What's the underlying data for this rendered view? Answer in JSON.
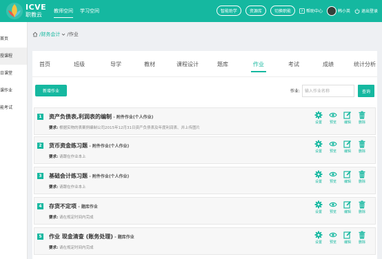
{
  "header": {
    "brand_main": "ICVE",
    "brand_sub": "职教云",
    "nav": [
      {
        "label": "教师空间",
        "active": true
      },
      {
        "label": "学习空间",
        "active": false
      }
    ],
    "pills": [
      "智能助学",
      "资源库",
      "切换职能"
    ],
    "help": "帮助中心",
    "user": "韩小英",
    "logout": "退出登录"
  },
  "sidebar": {
    "items": [
      {
        "label": "首页",
        "active": false
      },
      {
        "label": "授课程",
        "active": true
      },
      {
        "label": "日课堂",
        "active": false
      },
      {
        "label": "课作业",
        "active": false
      },
      {
        "label": "能考试",
        "active": false
      }
    ]
  },
  "breadcrumb": {
    "root": "/财务会计",
    "current": "/作业"
  },
  "tabs": [
    {
      "label": "首页",
      "active": false
    },
    {
      "label": "班级",
      "active": false
    },
    {
      "label": "导学",
      "active": false
    },
    {
      "label": "教材",
      "active": false
    },
    {
      "label": "课程设计",
      "active": false
    },
    {
      "label": "题库",
      "active": false
    },
    {
      "label": "作业",
      "active": true
    },
    {
      "label": "考试",
      "active": false
    },
    {
      "label": "成绩",
      "active": false
    },
    {
      "label": "统计分析",
      "active": false
    }
  ],
  "toolbar": {
    "new_label": "新增作业",
    "search_label": "作业:",
    "search_placeholder": "输入作业名称",
    "search_button": "查询"
  },
  "action_labels": {
    "settings": "设置",
    "preview": "预览",
    "edit": "编辑",
    "delete": "删除"
  },
  "assignments": [
    {
      "num": "1",
      "title": "资产负债表,利润表的编制",
      "type": "- 附件作业(个人作业)",
      "req_label": "要求:",
      "req": "根据实物的表案例编制公司2015年12月31日资产负债表及年度利润表、并上传图片"
    },
    {
      "num": "2",
      "title": "货币资金练习题",
      "type": "- 附件作业(个人作业)",
      "req_label": "要求:",
      "req": "请跟在作业本上"
    },
    {
      "num": "3",
      "title": "基础会计练习题",
      "type": "- 附件作业(个人作业)",
      "req_label": "要求:",
      "req": "请跟在作业本上"
    },
    {
      "num": "4",
      "title": "存货不定项",
      "type": "- 题库作业",
      "req_label": "要求:",
      "req": "请在规定时间内完成"
    },
    {
      "num": "5",
      "title": "作业 现金清查 (账务处理)",
      "type": "- 题库作业",
      "req_label": "要求:",
      "req": "请在规定时间内完成"
    }
  ],
  "colors": {
    "accent": "#15b8a0",
    "background": "#eef0f3"
  }
}
